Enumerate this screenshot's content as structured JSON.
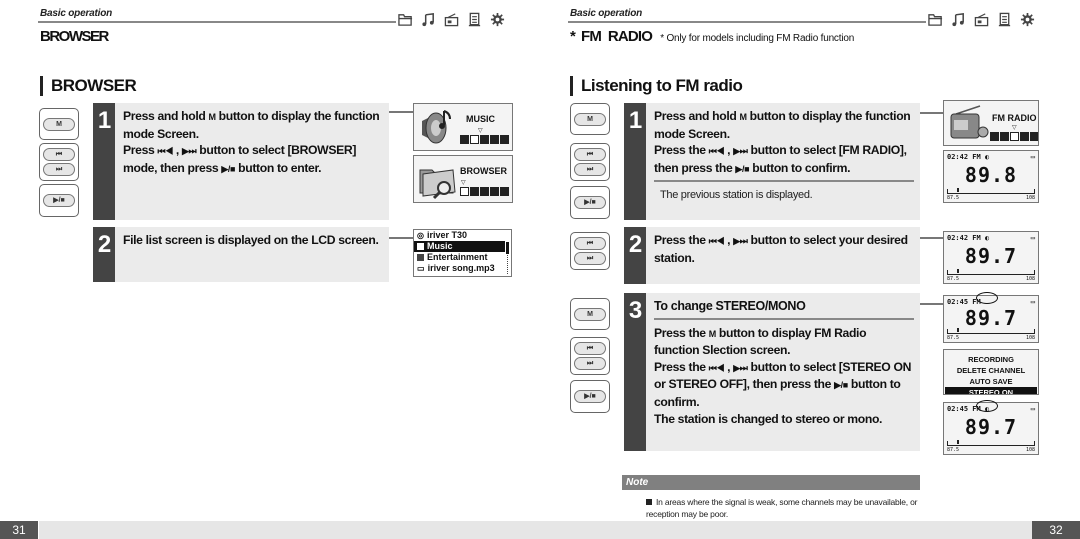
{
  "left_page": {
    "section_label": "Basic operation",
    "chapter_title": "BROWSER",
    "heading": "BROWSER",
    "mode_icons": [
      "folder-icon",
      "music-note-icon",
      "radio-icon",
      "document-icon",
      "gear-icon"
    ],
    "steps": [
      {
        "number": "1",
        "lines": [
          "Press and hold",
          "button to display the function mode Screen.",
          "Press",
          ",",
          "button to select [BROWSER] mode, then press",
          "button to enter."
        ]
      },
      {
        "number": "2",
        "text": "File list screen is displayed on the LCD screen."
      }
    ],
    "buttons": {
      "m": "M",
      "prev": "⏮",
      "next": "⏭",
      "play": "▶/■"
    },
    "lcd_music": {
      "label": "MUSIC"
    },
    "lcd_browser": {
      "label": "BROWSER"
    },
    "file_list": {
      "title": "iriver  T30",
      "items": [
        {
          "name": "Music",
          "selected": true
        },
        {
          "name": "Entertainment",
          "selected": false
        },
        {
          "name": "iriver song.mp3",
          "selected": false
        }
      ]
    },
    "page_number": "31"
  },
  "right_page": {
    "section_label": "Basic operation",
    "chapter_star": "*",
    "chapter_title": "FM  RADIO",
    "chapter_note": "* Only for models including FM Radio function",
    "heading": "Listening to FM radio",
    "steps": [
      {
        "number": "1",
        "lines": [
          "Press and hold",
          "button to display the function mode Screen.",
          "Press the",
          ",",
          "button to select [FM RADIO], then press the",
          "button to confirm."
        ],
        "sub": "The previous station is displayed."
      },
      {
        "number": "2",
        "lines": [
          "Press the",
          ",",
          "button to select your desired station."
        ]
      },
      {
        "number": "3",
        "title": "To change STEREO/MONO",
        "lines": [
          "Press the",
          "button to display FM Radio function Slection screen.",
          "Press the",
          ",",
          "button to select [STEREO ON or STEREO OFF], then press the",
          "button to confirm.",
          "The station is changed to stereo or mono."
        ]
      }
    ],
    "lcd_fm_mode": {
      "label": "FM RADIO"
    },
    "fm_screens": [
      {
        "time": "02:42",
        "band": "FM",
        "frequency": "89.8",
        "scale_min": "87.5",
        "scale_max": "108"
      },
      {
        "time": "02:42",
        "band": "FM",
        "frequency": "89.7",
        "scale_min": "87.5",
        "scale_max": "108"
      },
      {
        "time": "02:45",
        "band": "FM",
        "frequency": "89.7",
        "scale_min": "87.5",
        "scale_max": "108"
      },
      {
        "time": "02:45",
        "band": "FM",
        "frequency": "89.7",
        "scale_min": "87.5",
        "scale_max": "108"
      }
    ],
    "fm_menu": {
      "items": [
        {
          "label": "RECORDING",
          "selected": false
        },
        {
          "label": "DELETE CHANNEL",
          "selected": false
        },
        {
          "label": "AUTO SAVE",
          "selected": false
        },
        {
          "label": "STEREO ON",
          "selected": true
        }
      ]
    },
    "note": {
      "label": "Note",
      "text": "In areas where the signal is weak, some channels may be unavailable, or reception may be poor."
    },
    "page_number": "32"
  },
  "glyphs": {
    "m": "M",
    "prev": "⏮◀",
    "next": "▶⏭",
    "play": "▶/■"
  }
}
